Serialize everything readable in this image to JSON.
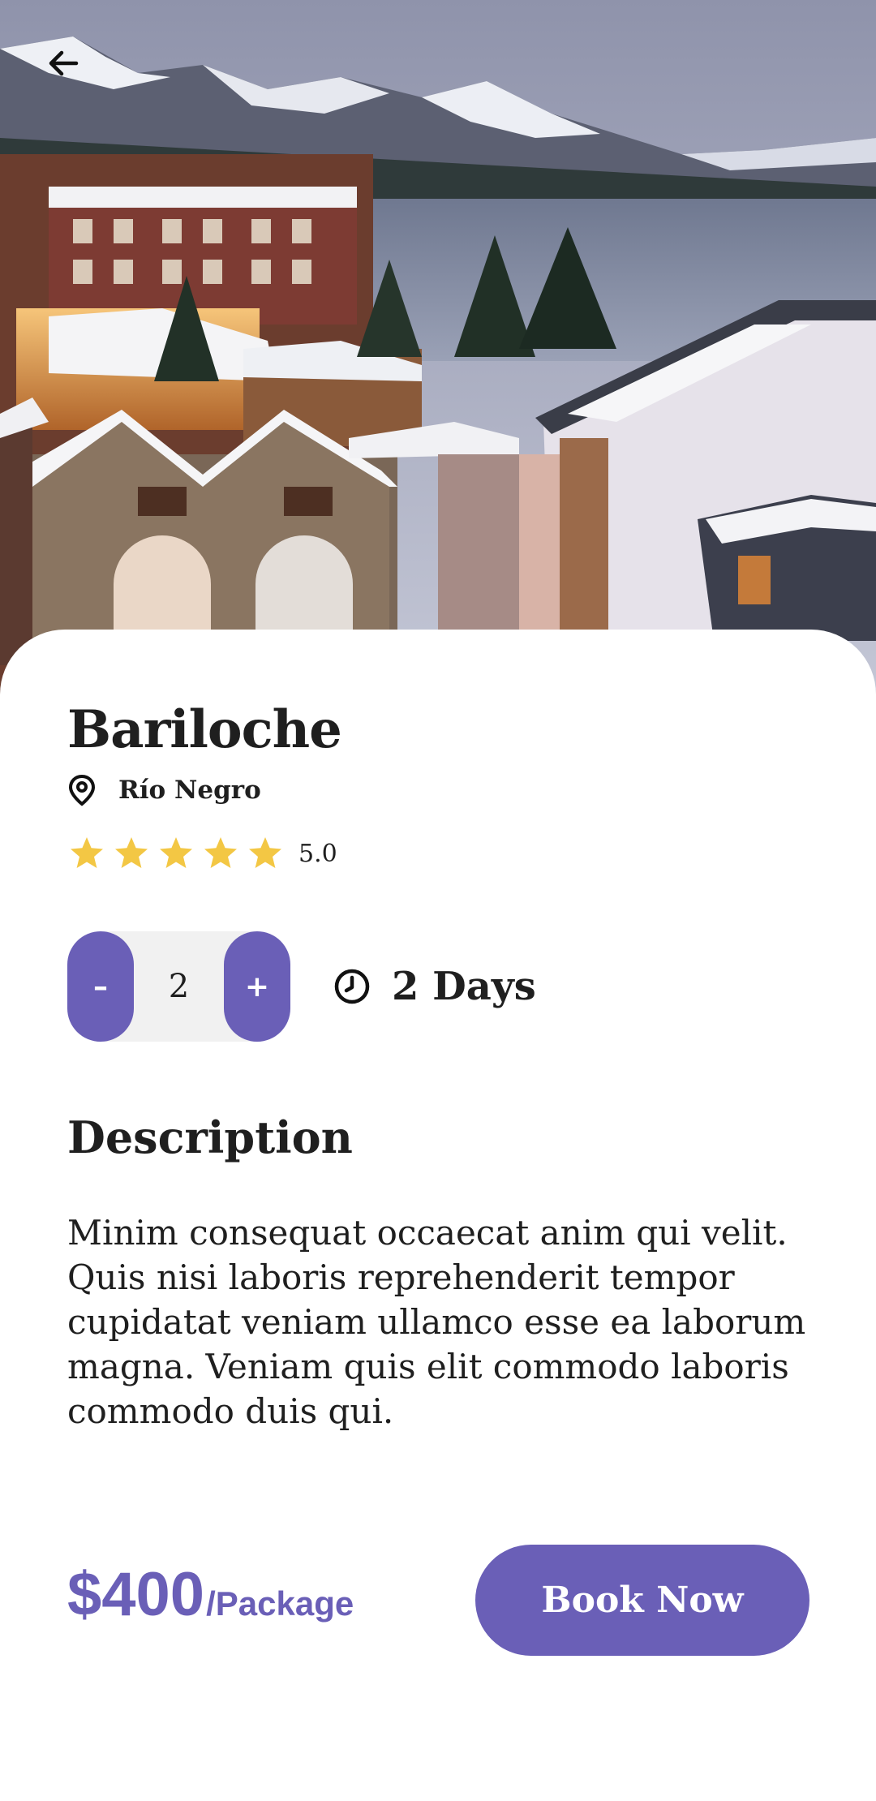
{
  "destination": {
    "name": "Bariloche",
    "location": "Río Negro",
    "rating": 5,
    "rating_label": "5.0"
  },
  "booking": {
    "quantity": "2",
    "decrement_label": "–",
    "increment_label": "+",
    "duration_label": "2 Days"
  },
  "description": {
    "heading": "Description",
    "body": "Minim consequat occaecat anim qui velit. Quis nisi laboris reprehenderit tempor cupidatat veniam ullamco esse ea laborum magna. Veniam quis elit commodo laboris commodo duis qui."
  },
  "footer": {
    "price": "$400",
    "price_unit": "/Package",
    "book_label": "Book Now"
  },
  "colors": {
    "accent": "#6a5fb7",
    "star": "#f3c744",
    "text": "#1f1f1f"
  },
  "icons": {
    "back": "arrow-left-icon",
    "location": "map-pin-icon",
    "rating": "star-icon",
    "duration": "clock-icon"
  }
}
